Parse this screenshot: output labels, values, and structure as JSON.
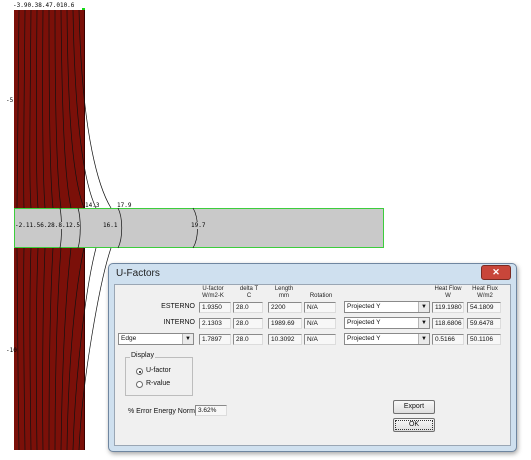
{
  "model": {
    "top_labels": "-3.90.38.47.010.6",
    "left_labels": [
      "-5",
      "-10"
    ],
    "slab_labels": {
      "left": "-2.11.56.28.8.12.5",
      "a": "16.1",
      "b": "19.7",
      "above_a": "14.3",
      "above_b": "17.9"
    }
  },
  "dialog": {
    "title": "U-Factors",
    "close_glyph": "✕",
    "headers": {
      "ufactor": [
        "U-factor",
        "W/m2-K"
      ],
      "deltat": [
        "delta T",
        "C"
      ],
      "length": [
        "Length",
        "mm"
      ],
      "rotation": [
        "Rotation"
      ],
      "heatflow": [
        "Heat Flow",
        "W"
      ],
      "heatflux": [
        "Heat Flux",
        "W/m2"
      ]
    },
    "rows": [
      {
        "label": "ESTERNO",
        "ufactor": "1.9350",
        "deltat": "28.0",
        "length": "2200",
        "rotation": "N/A",
        "projection": "Projected Y",
        "heatflow": "119.1980",
        "heatflux": "54.1809"
      },
      {
        "label": "INTERNO",
        "ufactor": "2.1303",
        "deltat": "28.0",
        "length": "1989.69",
        "rotation": "N/A",
        "projection": "Projected Y",
        "heatflow": "118.6806",
        "heatflux": "59.6478"
      },
      {
        "label": "Edge",
        "ufactor": "1.7897",
        "deltat": "28.0",
        "length": "10.3092",
        "rotation": "N/A",
        "projection": "Projected Y",
        "heatflow": "0.5166",
        "heatflux": "50.1106"
      }
    ],
    "display": {
      "legend": "Display",
      "option_ufactor": "U-factor",
      "option_rvalue": "R-value",
      "selected": "U-factor"
    },
    "error_label": "% Error Energy Norm",
    "error_value": "3.62%",
    "export_label": "Export",
    "ok_label": "OK"
  }
}
